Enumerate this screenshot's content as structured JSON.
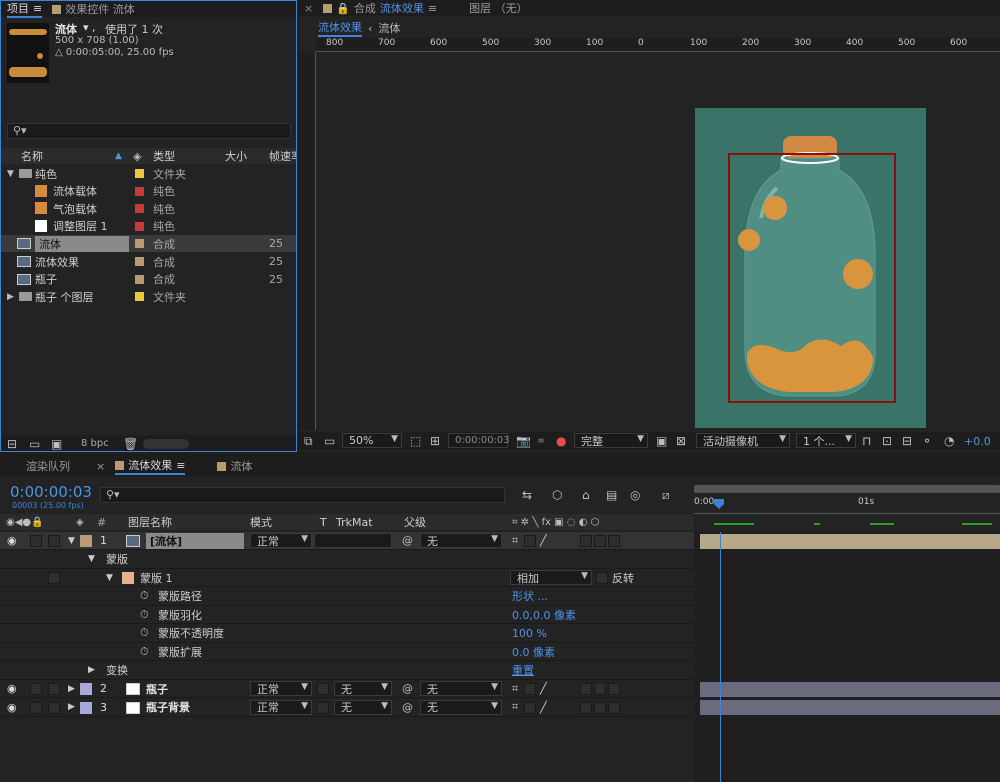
{
  "project": {
    "tab_label": "项目",
    "effects_tab": "效果控件 流体",
    "comp_name": "流体",
    "usage": "使用了 1 次",
    "dims": "500 x 708 (1.00)",
    "duration": "△ 0:00:05:00, 25.00 fps",
    "search_placeholder": "",
    "columns": {
      "name": "名称",
      "type": "类型",
      "size": "大小",
      "fps": "帧速率"
    },
    "items": [
      {
        "name": "纯色",
        "type": "文件夹",
        "size": "",
        "color": "#e8c840",
        "icon": "folder-icon",
        "indent": 0,
        "expanded": true
      },
      {
        "name": "流体载体",
        "type": "纯色",
        "size": "",
        "color": "#c63a3a",
        "icon": "solid-icon",
        "swatch": "#d58b3a",
        "indent": 1
      },
      {
        "name": "气泡载体",
        "type": "纯色",
        "size": "",
        "color": "#c63a3a",
        "icon": "solid-icon",
        "swatch": "#d58b3a",
        "indent": 1
      },
      {
        "name": "调整图层 1",
        "type": "纯色",
        "size": "",
        "color": "#c63a3a",
        "icon": "solid-icon",
        "swatch": "#ffffff",
        "indent": 1
      },
      {
        "name": "流体",
        "type": "合成",
        "size": "25",
        "color": "#b89b74",
        "icon": "comp-icon",
        "indent": 0,
        "selected": true
      },
      {
        "name": "流体效果",
        "type": "合成",
        "size": "25",
        "color": "#b89b74",
        "icon": "comp-icon",
        "indent": 0
      },
      {
        "name": "瓶子",
        "type": "合成",
        "size": "25",
        "color": "#b89b74",
        "icon": "comp-icon",
        "indent": 0
      },
      {
        "name": "瓶子 个图层",
        "type": "文件夹",
        "size": "",
        "color": "#e8c840",
        "icon": "folder-icon",
        "indent": 0,
        "expanded": false
      }
    ],
    "bpc": "8 bpc"
  },
  "composition": {
    "tab_label": "合成",
    "tab_name": "流体效果",
    "layer_tab": "图层 （无）",
    "breadcrumb": [
      "流体效果",
      "流体"
    ],
    "ruler_ticks": [
      "800",
      "700",
      "600",
      "500",
      "300",
      "100",
      "0",
      "100",
      "200",
      "300",
      "400",
      "500",
      "600"
    ],
    "zoom": "50%",
    "timecode": "0:00:00:03",
    "quality": "完整",
    "camera": "活动摄像机",
    "views": "1 个...",
    "exposure": "+0.0",
    "canvas_color": "#3a7468"
  },
  "timeline": {
    "render_tab": "渲染队列",
    "comp_tab": "流体效果",
    "other_tab": "流体",
    "timecode": "0:00:00:03",
    "frame_info": "00003 (25.00 fps)",
    "columns": {
      "num": "#",
      "layer_name": "图层名称",
      "mode": "模式",
      "t": "T",
      "trkmat": "TrkMat",
      "parent": "父级"
    },
    "time_marks": [
      "0:00s",
      "01s"
    ],
    "layers": [
      {
        "num": "1",
        "name": "[流体]",
        "mode": "正常",
        "trkmat": "",
        "parent": "无",
        "color": "#b89b74",
        "selected": true
      },
      {
        "num": "2",
        "name": "瓶子",
        "mode": "正常",
        "trkmat": "无",
        "parent": "无",
        "color": "#a9a9d8"
      },
      {
        "num": "3",
        "name": "瓶子背景",
        "mode": "正常",
        "trkmat": "无",
        "parent": "无",
        "color": "#a9a9d8"
      }
    ],
    "mask_group": "蒙版",
    "mask_name": "蒙版 1",
    "mask_mode": "相加",
    "invert": "反转",
    "mask_props": [
      {
        "name": "蒙版路径",
        "value": "形状 ..."
      },
      {
        "name": "蒙版羽化",
        "value": "0.0,0.0 像素"
      },
      {
        "name": "蒙版不透明度",
        "value": "100 %"
      },
      {
        "name": "蒙版扩展",
        "value": "0.0 像素"
      }
    ],
    "transform": "变换",
    "transform_value": "重置"
  }
}
